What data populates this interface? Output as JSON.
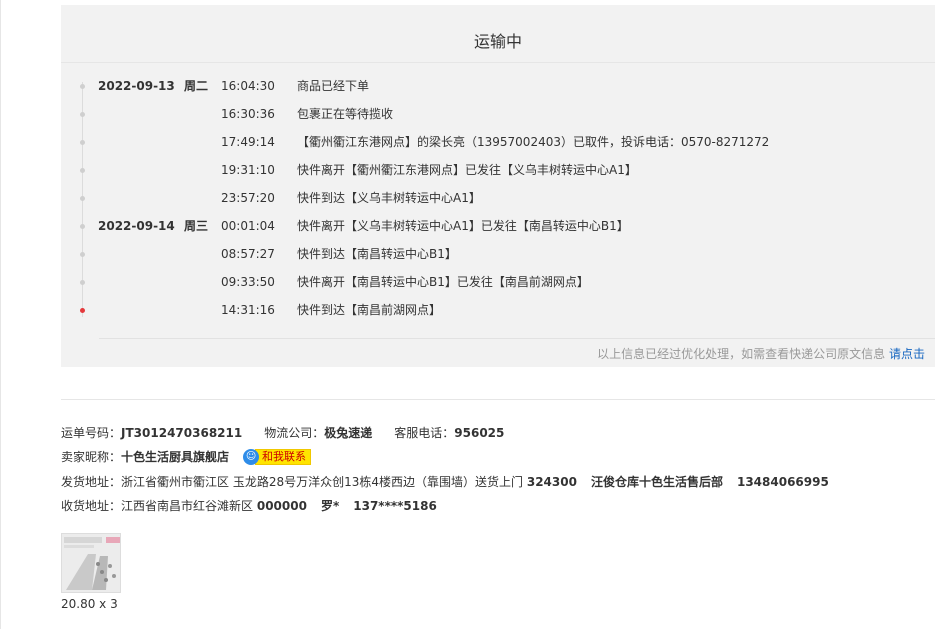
{
  "tracking": {
    "status_title": "运输中",
    "events": [
      {
        "date": "2022-09-13",
        "weekday": "周二",
        "time": "16:04:30",
        "desc": "商品已经下单",
        "active": false
      },
      {
        "date": "",
        "weekday": "",
        "time": "16:30:36",
        "desc": "包裹正在等待揽收",
        "active": false
      },
      {
        "date": "",
        "weekday": "",
        "time": "17:49:14",
        "desc": "【衢州衢江东港网点】的梁长亮（13957002403）已取件，投诉电话：0570-8271272",
        "active": false
      },
      {
        "date": "",
        "weekday": "",
        "time": "19:31:10",
        "desc": "快件离开【衢州衢江东港网点】已发往【义乌丰树转运中心A1】",
        "active": false
      },
      {
        "date": "",
        "weekday": "",
        "time": "23:57:20",
        "desc": "快件到达【义乌丰树转运中心A1】",
        "active": false
      },
      {
        "date": "2022-09-14",
        "weekday": "周三",
        "time": "00:01:04",
        "desc": "快件离开【义乌丰树转运中心A1】已发往【南昌转运中心B1】",
        "active": false
      },
      {
        "date": "",
        "weekday": "",
        "time": "08:57:27",
        "desc": "快件到达【南昌转运中心B1】",
        "active": false
      },
      {
        "date": "",
        "weekday": "",
        "time": "09:33:50",
        "desc": "快件离开【南昌转运中心B1】已发往【南昌前湖网点】",
        "active": false
      },
      {
        "date": "",
        "weekday": "",
        "time": "14:31:16",
        "desc": "快件到达【南昌前湖网点】",
        "active": true
      }
    ],
    "note_text": "以上信息已经过优化处理，如需查看快递公司原文信息",
    "note_link": "请点击"
  },
  "shipment": {
    "waybill_label": "运单号码：",
    "waybill_value": "JT3012470368211",
    "company_label": "物流公司：",
    "company_value": "极兔速递",
    "service_label": "客服电话：",
    "service_value": "956025"
  },
  "seller": {
    "label": "卖家昵称：",
    "name": "十色生活厨具旗舰店",
    "contact_label": "和我联系"
  },
  "sender": {
    "label": "发货地址：",
    "address": "浙江省衢州市衢江区 玉龙路28号万洋众创13栋4楼西边（靠围墙）送货上门",
    "postcode": "324300",
    "contact": "汪俊仓库十色生活售后部",
    "phone": "13484066995"
  },
  "receiver": {
    "label": "收货地址：",
    "address": "江西省南昌市红谷滩新区",
    "postcode": "000000",
    "name": "罗*",
    "phone": "137****5186"
  },
  "product": {
    "quantity_text": "20.80 x 3"
  }
}
